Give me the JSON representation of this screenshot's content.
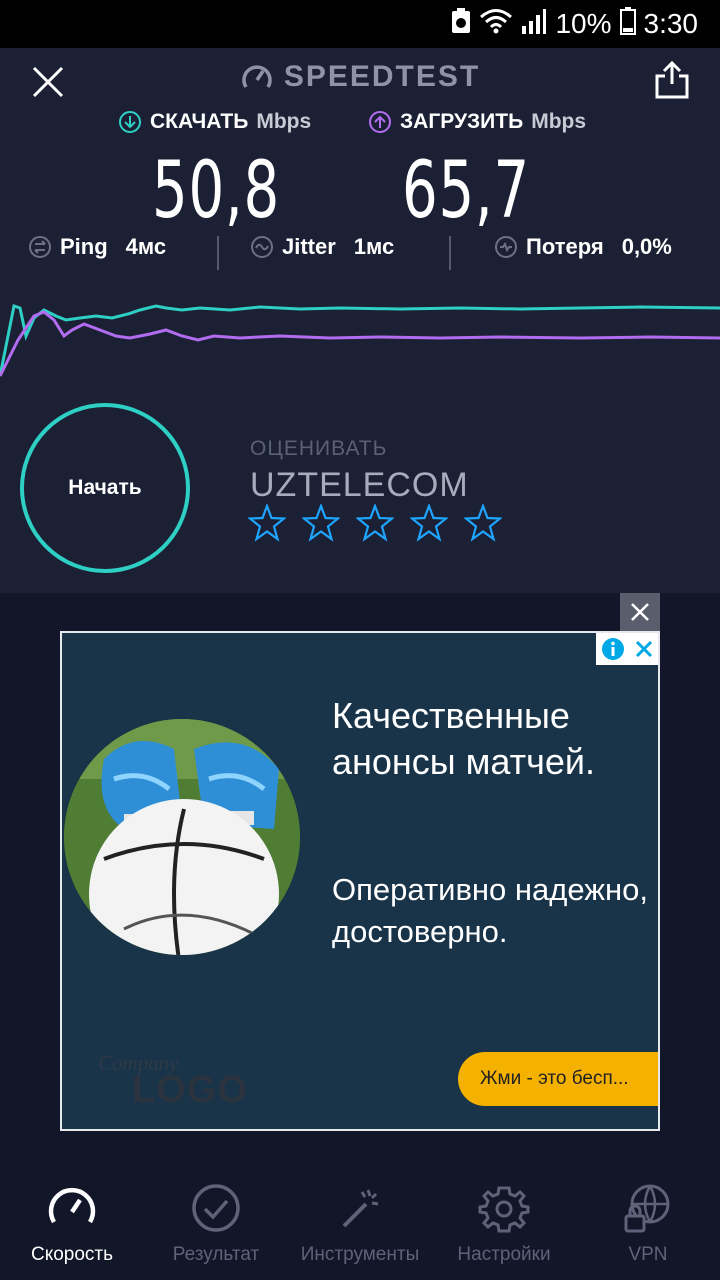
{
  "status_bar": {
    "battery_percent": "10%",
    "time": "3:30"
  },
  "header": {
    "title": "SPEEDTEST"
  },
  "metrics": {
    "download_label": "СКАЧАТЬ",
    "download_unit": "Mbps",
    "download_value": "50,8",
    "upload_label": "ЗАГРУЗИТЬ",
    "upload_unit": "Mbps",
    "upload_value": "65,7"
  },
  "stats": {
    "ping_label": "Ping",
    "ping_value": "4мс",
    "jitter_label": "Jitter",
    "jitter_value": "1мс",
    "loss_label": "Потеря",
    "loss_value": "0,0%"
  },
  "start_button": "Начать",
  "rating": {
    "label": "ОЦЕНИВАТЬ",
    "isp": "UZTELECOM",
    "stars": 0,
    "max_stars": 5
  },
  "ad": {
    "headline": "Качественные анонсы матчей.",
    "body": "Оперативно надежно, достоверно.",
    "logo_small": "Company",
    "logo_big": "LOGO",
    "cta": "Жми - это бесп..."
  },
  "nav": {
    "items": [
      {
        "label": "Скорость",
        "icon": "speedometer-icon",
        "active": true
      },
      {
        "label": "Результат",
        "icon": "check-circle-icon",
        "active": false
      },
      {
        "label": "Инструменты",
        "icon": "magic-wand-icon",
        "active": false
      },
      {
        "label": "Настройки",
        "icon": "gear-icon",
        "active": false
      },
      {
        "label": "VPN",
        "icon": "globe-lock-icon",
        "active": false
      }
    ]
  },
  "colors": {
    "download": "#2ecfc4",
    "upload": "#b26cf0",
    "star": "#1ea5ff",
    "cta": "#f4b100"
  }
}
